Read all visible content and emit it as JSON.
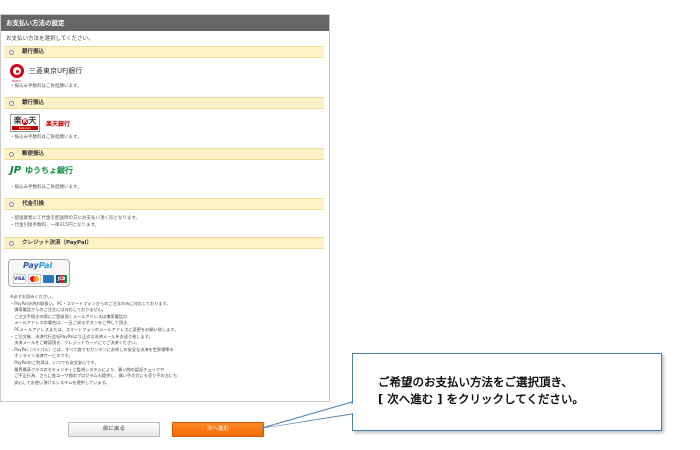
{
  "panel": {
    "title": "お支払い方法の設定",
    "intro": "お支払い方法を選択してください。"
  },
  "options": [
    {
      "label": "銀行振込",
      "logo_text": "三菱東京UFJ銀行",
      "logo_sub": "MUFG",
      "note": "・振込み手数料はご負担願います。"
    },
    {
      "label": "銀行振込",
      "logo_top": "楽",
      "logo_mark": "R",
      "logo_top2": "天",
      "logo_bottom": "Rakuten",
      "logo_text": "楽天銀行",
      "note": "・振込み手数料はご負担願います。"
    },
    {
      "label": "郵便振込",
      "logo_mark": "JP",
      "logo_text": "ゆうちょ銀行",
      "note": "・振込み手数料はご負担願います。"
    },
    {
      "label": "代金引換",
      "notes": [
        "・配送業者にて代金を配送時の方にお支払い頂く形となります。",
        "・代金引換手数料、一律315円となります。"
      ]
    },
    {
      "label": "クレジット決済（PayPal）",
      "paypal_word_1": "Pay",
      "paypal_word_2": "Pal",
      "cards": [
        "VISA",
        "",
        "",
        "JCB"
      ]
    }
  ],
  "paypal_notes": [
    "※必ずお読みください。",
    "・PayPal決済お取扱い、PC・スマートフォンからのご注文のみに対応しております。",
    "　携帯電話からのご注文には対応しておりません。",
    "　ご注文手続きの際にご登録頂くメールアドレスは携帯電話の",
    "　メールアドレスの場合は、一旦ご戻るボタンをご押して頂き、",
    "　PCメールアドレスまたは、スマートフォンのメールアドレスに変更をお願い致します。",
    "・ご注文後、決済代行会社PayPalより正式な決済メールをお送り致します。",
    "　決済メールをご確認頂き、クレジットカードにてご決済ください。",
    "・PayPal（ペイパル）とは、すべて誰でもカンタンにお申しの安全な決済を世界標準の",
    "　オンライン決済サービスです。",
    "　PayPalのご利用は、いつでも安全安心です。",
    "　業界最高クラスのセキュリティと監視システムにより、買い物の認証チェックや",
    "　ご不正行為、さらに各ユーザ間のプログラムも提供し、買い手の方にも売り手の方にも",
    "　安心してお使い頂けるシステムを提供しています。"
  ],
  "buttons": {
    "back": "前に戻る",
    "next": "次へ進む"
  },
  "callout": {
    "line1": "ご希望のお支払い方法をご選択頂き、",
    "line2": "[ 次へ進む ] をクリックしてください。"
  },
  "colors": {
    "header_bg": "#666666",
    "option_bar_bg": "#fdf1c8",
    "next_button": "#f06a00",
    "callout_border": "#4a7fb5"
  }
}
